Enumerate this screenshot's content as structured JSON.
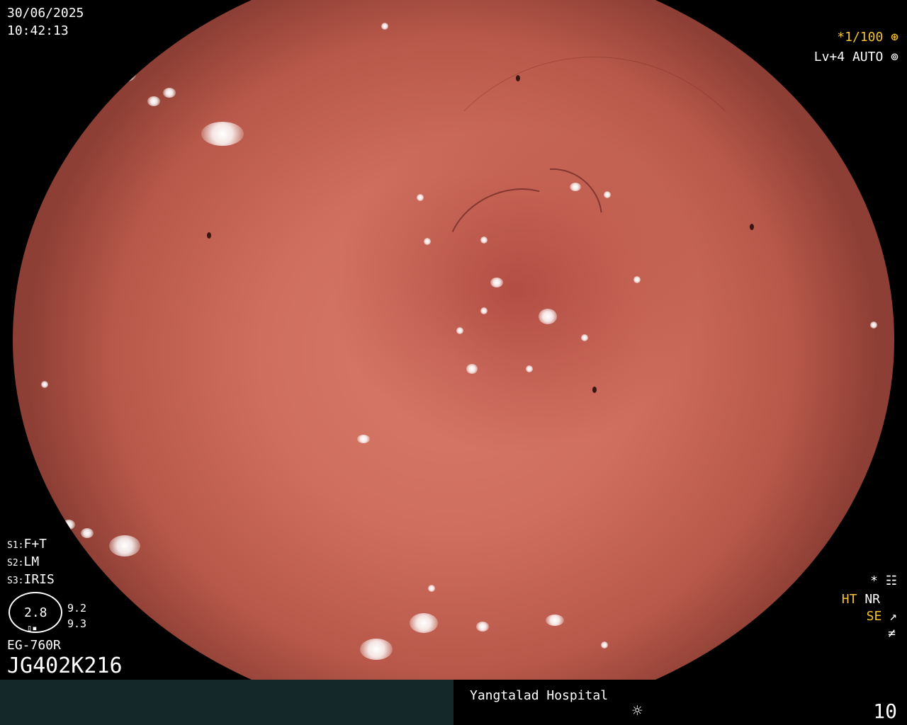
{
  "header": {
    "date": "30/06/2025",
    "time": "10:42:13"
  },
  "settings": {
    "shutter": "*1/100",
    "shutter_icon": "shutter-icon",
    "level": "Lv+4 AUTO",
    "auto_icon": "iris-icon",
    "s1": "F+T",
    "s2": "LM",
    "s3": "IRIS",
    "s1_label": "S1:",
    "s2_label": "S2:",
    "s3_label": "S3:"
  },
  "gauge": {
    "value": "2.8",
    "side_top": "9.2",
    "side_bottom": "9.3"
  },
  "scope": {
    "model": "EG-760R",
    "serial": "JG402K216"
  },
  "modes": {
    "star": "*",
    "ht": "HT",
    "nr": "NR",
    "se": "SE"
  },
  "footer": {
    "hospital": "Yangtalad Hospital",
    "light_icon": "sun-icon",
    "image_count": "10"
  },
  "colors": {
    "accent_yellow": "#f2c230",
    "bar_teal": "#14282a"
  }
}
